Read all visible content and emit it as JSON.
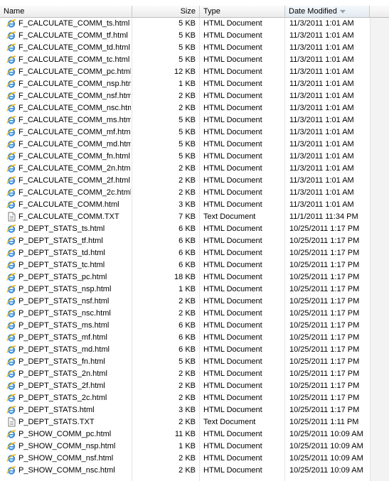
{
  "header": {
    "name": "Name",
    "size": "Size",
    "type": "Type",
    "date": "Date Modified"
  },
  "files": [
    {
      "name": "F_CALCULATE_COMM_ts.html",
      "size": "5 KB",
      "type": "HTML Document",
      "date": "11/3/2011 1:01 AM",
      "icon": "ie-icon"
    },
    {
      "name": "F_CALCULATE_COMM_tf.html",
      "size": "5 KB",
      "type": "HTML Document",
      "date": "11/3/2011 1:01 AM",
      "icon": "ie-icon"
    },
    {
      "name": "F_CALCULATE_COMM_td.html",
      "size": "5 KB",
      "type": "HTML Document",
      "date": "11/3/2011 1:01 AM",
      "icon": "ie-icon"
    },
    {
      "name": "F_CALCULATE_COMM_tc.html",
      "size": "5 KB",
      "type": "HTML Document",
      "date": "11/3/2011 1:01 AM",
      "icon": "ie-icon"
    },
    {
      "name": "F_CALCULATE_COMM_pc.html",
      "size": "12 KB",
      "type": "HTML Document",
      "date": "11/3/2011 1:01 AM",
      "icon": "ie-icon"
    },
    {
      "name": "F_CALCULATE_COMM_nsp.html",
      "size": "1 KB",
      "type": "HTML Document",
      "date": "11/3/2011 1:01 AM",
      "icon": "ie-icon"
    },
    {
      "name": "F_CALCULATE_COMM_nsf.html",
      "size": "2 KB",
      "type": "HTML Document",
      "date": "11/3/2011 1:01 AM",
      "icon": "ie-icon"
    },
    {
      "name": "F_CALCULATE_COMM_nsc.html",
      "size": "2 KB",
      "type": "HTML Document",
      "date": "11/3/2011 1:01 AM",
      "icon": "ie-icon"
    },
    {
      "name": "F_CALCULATE_COMM_ms.html",
      "size": "5 KB",
      "type": "HTML Document",
      "date": "11/3/2011 1:01 AM",
      "icon": "ie-icon"
    },
    {
      "name": "F_CALCULATE_COMM_mf.html",
      "size": "5 KB",
      "type": "HTML Document",
      "date": "11/3/2011 1:01 AM",
      "icon": "ie-icon"
    },
    {
      "name": "F_CALCULATE_COMM_md.html",
      "size": "5 KB",
      "type": "HTML Document",
      "date": "11/3/2011 1:01 AM",
      "icon": "ie-icon"
    },
    {
      "name": "F_CALCULATE_COMM_fn.html",
      "size": "5 KB",
      "type": "HTML Document",
      "date": "11/3/2011 1:01 AM",
      "icon": "ie-icon"
    },
    {
      "name": "F_CALCULATE_COMM_2n.html",
      "size": "2 KB",
      "type": "HTML Document",
      "date": "11/3/2011 1:01 AM",
      "icon": "ie-icon"
    },
    {
      "name": "F_CALCULATE_COMM_2f.html",
      "size": "2 KB",
      "type": "HTML Document",
      "date": "11/3/2011 1:01 AM",
      "icon": "ie-icon"
    },
    {
      "name": "F_CALCULATE_COMM_2c.html",
      "size": "2 KB",
      "type": "HTML Document",
      "date": "11/3/2011 1:01 AM",
      "icon": "ie-icon"
    },
    {
      "name": "F_CALCULATE_COMM.html",
      "size": "3 KB",
      "type": "HTML Document",
      "date": "11/3/2011 1:01 AM",
      "icon": "ie-icon"
    },
    {
      "name": "F_CALCULATE_COMM.TXT",
      "size": "7 KB",
      "type": "Text Document",
      "date": "11/1/2011 11:34 PM",
      "icon": "text-file-icon"
    },
    {
      "name": "P_DEPT_STATS_ts.html",
      "size": "6 KB",
      "type": "HTML Document",
      "date": "10/25/2011 1:17 PM",
      "icon": "ie-icon"
    },
    {
      "name": "P_DEPT_STATS_tf.html",
      "size": "6 KB",
      "type": "HTML Document",
      "date": "10/25/2011 1:17 PM",
      "icon": "ie-icon"
    },
    {
      "name": "P_DEPT_STATS_td.html",
      "size": "6 KB",
      "type": "HTML Document",
      "date": "10/25/2011 1:17 PM",
      "icon": "ie-icon"
    },
    {
      "name": "P_DEPT_STATS_tc.html",
      "size": "6 KB",
      "type": "HTML Document",
      "date": "10/25/2011 1:17 PM",
      "icon": "ie-icon"
    },
    {
      "name": "P_DEPT_STATS_pc.html",
      "size": "18 KB",
      "type": "HTML Document",
      "date": "10/25/2011 1:17 PM",
      "icon": "ie-icon"
    },
    {
      "name": "P_DEPT_STATS_nsp.html",
      "size": "1 KB",
      "type": "HTML Document",
      "date": "10/25/2011 1:17 PM",
      "icon": "ie-icon"
    },
    {
      "name": "P_DEPT_STATS_nsf.html",
      "size": "2 KB",
      "type": "HTML Document",
      "date": "10/25/2011 1:17 PM",
      "icon": "ie-icon"
    },
    {
      "name": "P_DEPT_STATS_nsc.html",
      "size": "2 KB",
      "type": "HTML Document",
      "date": "10/25/2011 1:17 PM",
      "icon": "ie-icon"
    },
    {
      "name": "P_DEPT_STATS_ms.html",
      "size": "6 KB",
      "type": "HTML Document",
      "date": "10/25/2011 1:17 PM",
      "icon": "ie-icon"
    },
    {
      "name": "P_DEPT_STATS_mf.html",
      "size": "6 KB",
      "type": "HTML Document",
      "date": "10/25/2011 1:17 PM",
      "icon": "ie-icon"
    },
    {
      "name": "P_DEPT_STATS_md.html",
      "size": "6 KB",
      "type": "HTML Document",
      "date": "10/25/2011 1:17 PM",
      "icon": "ie-icon"
    },
    {
      "name": "P_DEPT_STATS_fn.html",
      "size": "5 KB",
      "type": "HTML Document",
      "date": "10/25/2011 1:17 PM",
      "icon": "ie-icon"
    },
    {
      "name": "P_DEPT_STATS_2n.html",
      "size": "2 KB",
      "type": "HTML Document",
      "date": "10/25/2011 1:17 PM",
      "icon": "ie-icon"
    },
    {
      "name": "P_DEPT_STATS_2f.html",
      "size": "2 KB",
      "type": "HTML Document",
      "date": "10/25/2011 1:17 PM",
      "icon": "ie-icon"
    },
    {
      "name": "P_DEPT_STATS_2c.html",
      "size": "2 KB",
      "type": "HTML Document",
      "date": "10/25/2011 1:17 PM",
      "icon": "ie-icon"
    },
    {
      "name": "P_DEPT_STATS.html",
      "size": "3 KB",
      "type": "HTML Document",
      "date": "10/25/2011 1:17 PM",
      "icon": "ie-icon"
    },
    {
      "name": "P_DEPT_STATS.TXT",
      "size": "2 KB",
      "type": "Text Document",
      "date": "10/25/2011 1:11 PM",
      "icon": "text-file-icon"
    },
    {
      "name": "P_SHOW_COMM_pc.html",
      "size": "11 KB",
      "type": "HTML Document",
      "date": "10/25/2011 10:09 AM",
      "icon": "ie-icon"
    },
    {
      "name": "P_SHOW_COMM_nsp.html",
      "size": "1 KB",
      "type": "HTML Document",
      "date": "10/25/2011 10:09 AM",
      "icon": "ie-icon"
    },
    {
      "name": "P_SHOW_COMM_nsf.html",
      "size": "2 KB",
      "type": "HTML Document",
      "date": "10/25/2011 10:09 AM",
      "icon": "ie-icon"
    },
    {
      "name": "P_SHOW_COMM_nsc.html",
      "size": "2 KB",
      "type": "HTML Document",
      "date": "10/25/2011 10:09 AM",
      "icon": "ie-icon"
    }
  ]
}
